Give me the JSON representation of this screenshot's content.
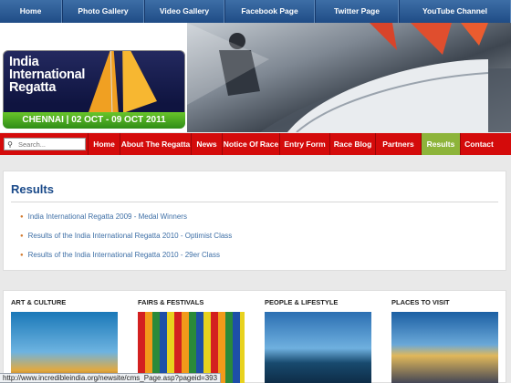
{
  "top_nav": [
    "Home",
    "Photo Gallery",
    "Video Gallery",
    "Facebook Page",
    "Twitter Page",
    "YouTube Channel"
  ],
  "logo": {
    "title_line1": "India",
    "title_line2": "International",
    "title_line3": "Regatta",
    "dates": "CHENNAI | 02 OCT - 09 OCT 2011"
  },
  "search": {
    "placeholder": "Search..."
  },
  "main_nav": [
    "Home",
    "About The Regatta",
    "News",
    "Notice Of Race",
    "Entry Form",
    "Race Blog",
    "Partners",
    "Results",
    "Contact"
  ],
  "results": {
    "heading": "Results",
    "links": [
      "India International Regatta 2009 - Medal Winners",
      "Results of the India International Regatta 2010 - Optimist Class",
      "Results of the India International Regatta 2010 - 29er Class"
    ]
  },
  "categories": [
    "ART & CULTURE",
    "FAIRS & FESTIVALS",
    "PEOPLE & LIFESTYLE",
    "PLACES TO VISIT"
  ],
  "status_bar": "http://www.incredibleindia.org/newsite/cms_Page.asp?pageid=393",
  "colors": {
    "top_nav": "#2a5a94",
    "main_nav": "#d40b0b",
    "active_tab": "#8db43a",
    "heading": "#1a4a8a",
    "link": "#3e6fa6"
  }
}
